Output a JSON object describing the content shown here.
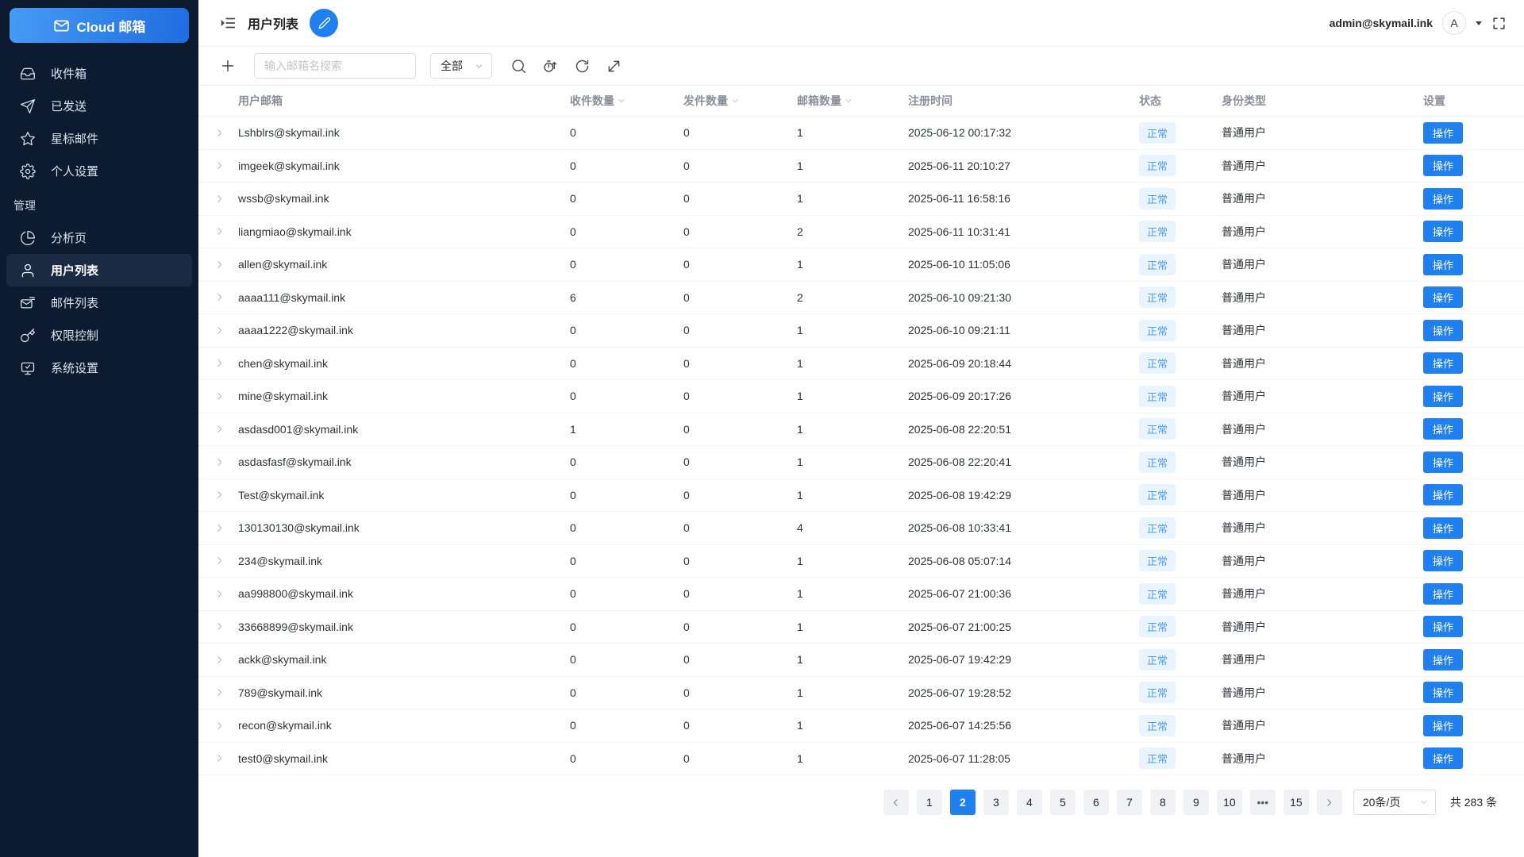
{
  "app": {
    "logo_label": "Cloud 邮箱",
    "account_email": "admin@skymail.ink",
    "avatar_letter": "A"
  },
  "sidebar": {
    "items": [
      {
        "label": "收件箱",
        "icon": "inbox-icon"
      },
      {
        "label": "已发送",
        "icon": "send-icon"
      },
      {
        "label": "星标邮件",
        "icon": "star-icon"
      },
      {
        "label": "个人设置",
        "icon": "gear-icon"
      }
    ],
    "section_label": "管理",
    "admin_items": [
      {
        "label": "分析页",
        "icon": "pie-chart-icon",
        "active": false
      },
      {
        "label": "用户列表",
        "icon": "user-icon",
        "active": true
      },
      {
        "label": "邮件列表",
        "icon": "mail-list-icon",
        "active": false
      },
      {
        "label": "权限控制",
        "icon": "key-icon",
        "active": false
      },
      {
        "label": "系统设置",
        "icon": "monitor-icon",
        "active": false
      }
    ]
  },
  "header": {
    "title": "用户列表"
  },
  "toolbar": {
    "search_placeholder": "输入邮箱名搜索",
    "filter_value": "全部"
  },
  "table": {
    "columns": [
      {
        "label": "用户邮箱",
        "sortable": false
      },
      {
        "label": "收件数量",
        "sortable": true
      },
      {
        "label": "发件数量",
        "sortable": true
      },
      {
        "label": "邮箱数量",
        "sortable": true
      },
      {
        "label": "注册时间",
        "sortable": false
      },
      {
        "label": "状态",
        "sortable": false
      },
      {
        "label": "身份类型",
        "sortable": false
      },
      {
        "label": "设置",
        "sortable": false
      }
    ],
    "action_label": "操作",
    "rows": [
      {
        "email": "Lshblrs@skymail.ink",
        "received": "0",
        "sent": "0",
        "mailboxes": "1",
        "registered": "2025-06-12 00:17:32",
        "status": "正常",
        "identity": "普通用户"
      },
      {
        "email": "imgeek@skymail.ink",
        "received": "0",
        "sent": "0",
        "mailboxes": "1",
        "registered": "2025-06-11 20:10:27",
        "status": "正常",
        "identity": "普通用户"
      },
      {
        "email": "wssb@skymail.ink",
        "received": "0",
        "sent": "0",
        "mailboxes": "1",
        "registered": "2025-06-11 16:58:16",
        "status": "正常",
        "identity": "普通用户"
      },
      {
        "email": "liangmiao@skymail.ink",
        "received": "0",
        "sent": "0",
        "mailboxes": "2",
        "registered": "2025-06-11 10:31:41",
        "status": "正常",
        "identity": "普通用户"
      },
      {
        "email": "allen@skymail.ink",
        "received": "0",
        "sent": "0",
        "mailboxes": "1",
        "registered": "2025-06-10 11:05:06",
        "status": "正常",
        "identity": "普通用户"
      },
      {
        "email": "aaaa111@skymail.ink",
        "received": "6",
        "sent": "0",
        "mailboxes": "2",
        "registered": "2025-06-10 09:21:30",
        "status": "正常",
        "identity": "普通用户"
      },
      {
        "email": "aaaa1222@skymail.ink",
        "received": "0",
        "sent": "0",
        "mailboxes": "1",
        "registered": "2025-06-10 09:21:11",
        "status": "正常",
        "identity": "普通用户"
      },
      {
        "email": "chen@skymail.ink",
        "received": "0",
        "sent": "0",
        "mailboxes": "1",
        "registered": "2025-06-09 20:18:44",
        "status": "正常",
        "identity": "普通用户"
      },
      {
        "email": "mine@skymail.ink",
        "received": "0",
        "sent": "0",
        "mailboxes": "1",
        "registered": "2025-06-09 20:17:26",
        "status": "正常",
        "identity": "普通用户"
      },
      {
        "email": "asdasd001@skymail.ink",
        "received": "1",
        "sent": "0",
        "mailboxes": "1",
        "registered": "2025-06-08 22:20:51",
        "status": "正常",
        "identity": "普通用户"
      },
      {
        "email": "asdasfasf@skymail.ink",
        "received": "0",
        "sent": "0",
        "mailboxes": "1",
        "registered": "2025-06-08 22:20:41",
        "status": "正常",
        "identity": "普通用户"
      },
      {
        "email": "Test@skymail.ink",
        "received": "0",
        "sent": "0",
        "mailboxes": "1",
        "registered": "2025-06-08 19:42:29",
        "status": "正常",
        "identity": "普通用户"
      },
      {
        "email": "130130130@skymail.ink",
        "received": "0",
        "sent": "0",
        "mailboxes": "4",
        "registered": "2025-06-08 10:33:41",
        "status": "正常",
        "identity": "普通用户"
      },
      {
        "email": "234@skymail.ink",
        "received": "0",
        "sent": "0",
        "mailboxes": "1",
        "registered": "2025-06-08 05:07:14",
        "status": "正常",
        "identity": "普通用户"
      },
      {
        "email": "aa998800@skymail.ink",
        "received": "0",
        "sent": "0",
        "mailboxes": "1",
        "registered": "2025-06-07 21:00:36",
        "status": "正常",
        "identity": "普通用户"
      },
      {
        "email": "33668899@skymail.ink",
        "received": "0",
        "sent": "0",
        "mailboxes": "1",
        "registered": "2025-06-07 21:00:25",
        "status": "正常",
        "identity": "普通用户"
      },
      {
        "email": "ackk@skymail.ink",
        "received": "0",
        "sent": "0",
        "mailboxes": "1",
        "registered": "2025-06-07 19:42:29",
        "status": "正常",
        "identity": "普通用户"
      },
      {
        "email": "789@skymail.ink",
        "received": "0",
        "sent": "0",
        "mailboxes": "1",
        "registered": "2025-06-07 19:28:52",
        "status": "正常",
        "identity": "普通用户"
      },
      {
        "email": "recon@skymail.ink",
        "received": "0",
        "sent": "0",
        "mailboxes": "1",
        "registered": "2025-06-07 14:25:56",
        "status": "正常",
        "identity": "普通用户"
      },
      {
        "email": "test0@skymail.ink",
        "received": "0",
        "sent": "0",
        "mailboxes": "1",
        "registered": "2025-06-07 11:28:05",
        "status": "正常",
        "identity": "普通用户"
      }
    ]
  },
  "pagination": {
    "pages": [
      "1",
      "2",
      "3",
      "4",
      "5",
      "6",
      "7",
      "8",
      "9",
      "10"
    ],
    "active_page": "2",
    "more_label": "•••",
    "last_page": "15",
    "page_size": "20条/页",
    "total": "共 283 条"
  },
  "colors": {
    "accent": "#2080F0",
    "sidebar_bg": "#0C1B30",
    "sidebar_active_bg": "#1A2A42",
    "status_badge_bg": "#E8F4FF",
    "status_badge_text": "#519CF0"
  }
}
